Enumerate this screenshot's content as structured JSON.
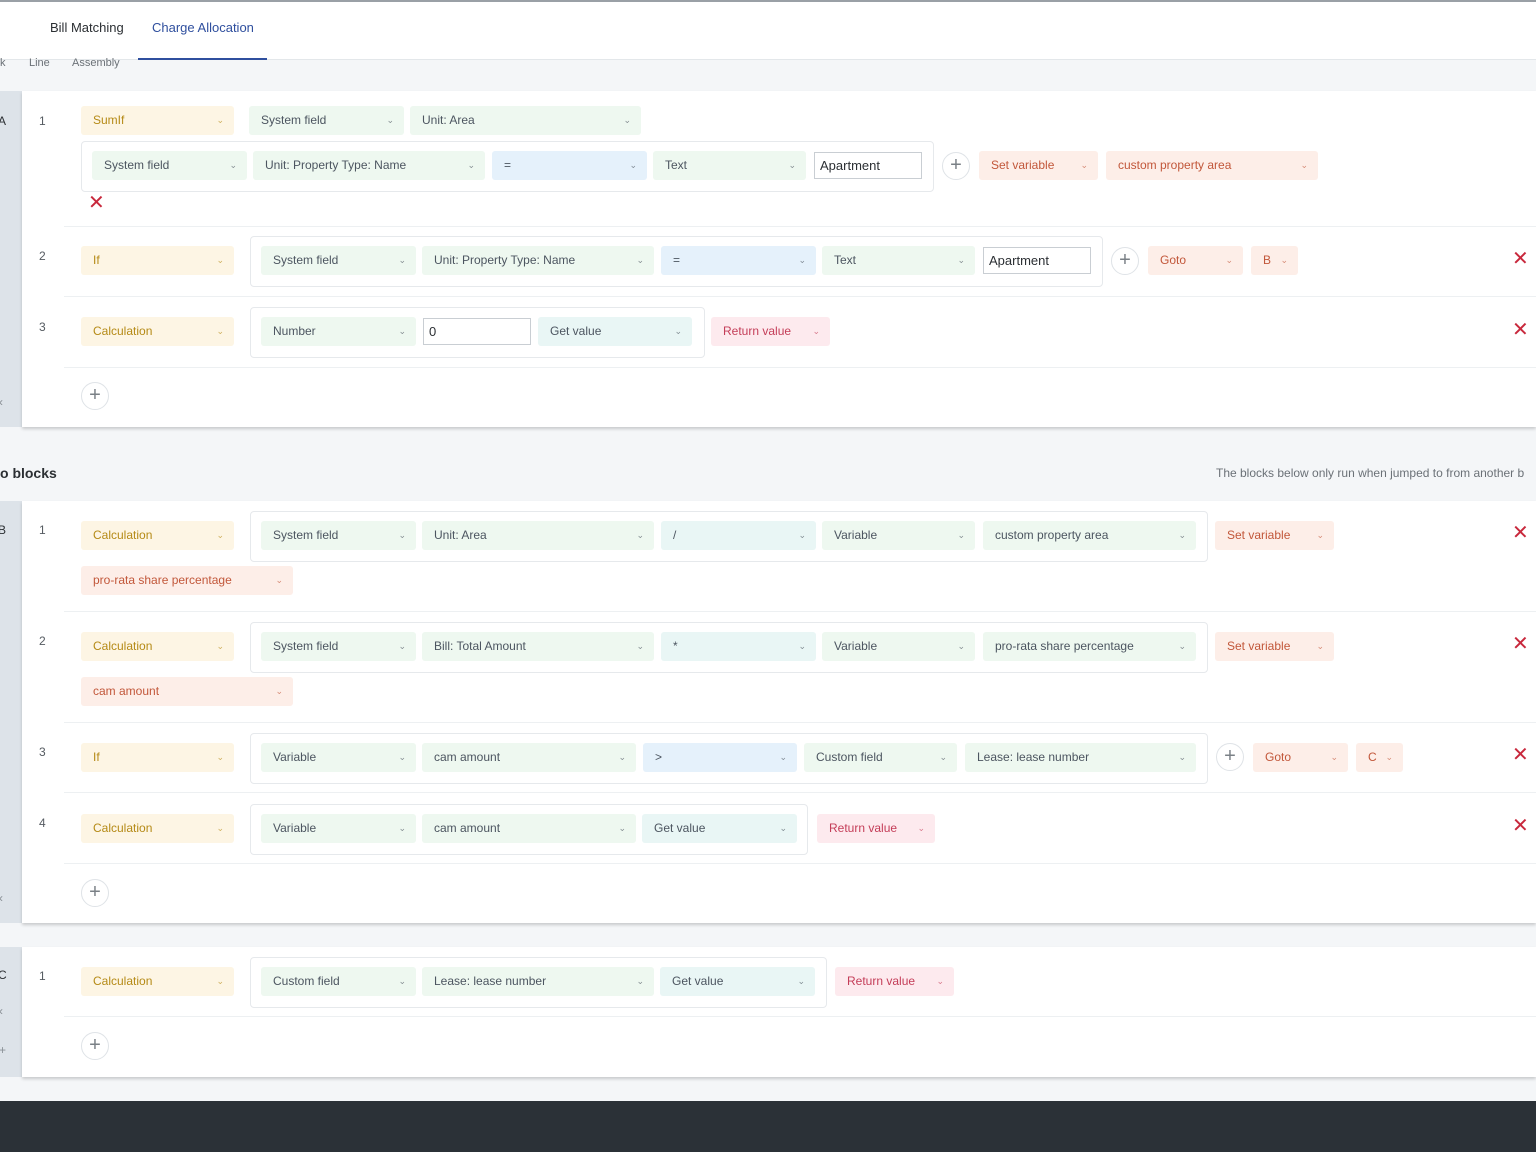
{
  "tabs": [
    {
      "label": "Bill Matching",
      "active": false
    },
    {
      "label": "Charge Allocation",
      "active": true
    }
  ],
  "subtabs": [
    "k",
    "Line",
    "Assembly"
  ],
  "strip": {
    "a": "A",
    "b": "B",
    "c": "C",
    "chev": "‹",
    "plus": "+"
  },
  "blockA": {
    "rows": [
      {
        "num": "1",
        "type": "SumIf",
        "d1": "System field",
        "d2": "Unit: Area",
        "cond": {
          "f1": "System field",
          "f2": "Unit: Property Type: Name",
          "op": "=",
          "f3": "Text",
          "value": "Apartment"
        },
        "action": "Set variable",
        "target": "custom property area"
      },
      {
        "num": "2",
        "type": "If",
        "f1": "System field",
        "f2": "Unit: Property Type: Name",
        "op": "=",
        "f3": "Text",
        "value": "Apartment",
        "action": "Goto",
        "target": "B"
      },
      {
        "num": "3",
        "type": "Calculation",
        "f1": "Number",
        "value": "0",
        "f2": "Get value",
        "action": "Return value"
      }
    ]
  },
  "jump_section": {
    "title": "o blocks",
    "note": "The blocks below only run when jumped to from another b"
  },
  "blockB": {
    "rows": [
      {
        "num": "1",
        "type": "Calculation",
        "f1": "System field",
        "f2": "Unit: Area",
        "op": "/",
        "f3": "Variable",
        "f4": "custom property area",
        "action": "Set variable",
        "target": "pro-rata share percentage"
      },
      {
        "num": "2",
        "type": "Calculation",
        "f1": "System field",
        "f2": "Bill: Total Amount",
        "op": "*",
        "f3": "Variable",
        "f4": "pro-rata share percentage",
        "action": "Set variable",
        "target": "cam amount"
      },
      {
        "num": "3",
        "type": "If",
        "f1": "Variable",
        "f2": "cam amount",
        "op": ">",
        "f3": "Custom field",
        "f4": "Lease: lease number",
        "action": "Goto",
        "target": "C"
      },
      {
        "num": "4",
        "type": "Calculation",
        "f1": "Variable",
        "f2": "cam amount",
        "f3": "Get value",
        "action": "Return value"
      }
    ]
  },
  "blockC": {
    "rows": [
      {
        "num": "1",
        "type": "Calculation",
        "f1": "Custom field",
        "f2": "Lease: lease number",
        "f3": "Get value",
        "action": "Return value"
      }
    ]
  },
  "icons": {
    "chevron": "⌄",
    "plus": "+",
    "close": "✕"
  },
  "colors": {
    "accent": "#2f4f9e",
    "delete": "#c8283c",
    "yellow": "#b58a16",
    "salmon": "#c2573a",
    "pink": "#c43d58"
  }
}
